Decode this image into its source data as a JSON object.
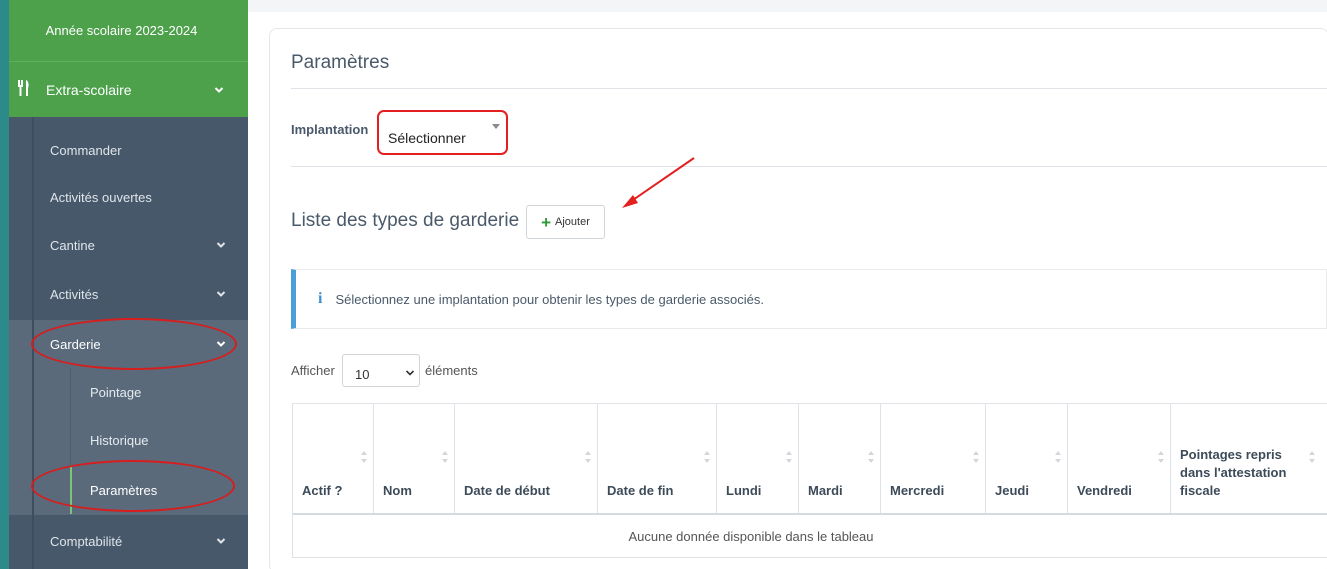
{
  "sidebar": {
    "school_year": "Année scolaire 2023-2024",
    "section": "Extra-scolaire",
    "items": [
      {
        "label": "Commander"
      },
      {
        "label": "Activités ouvertes"
      },
      {
        "label": "Cantine"
      },
      {
        "label": "Activités"
      },
      {
        "label": "Garderie"
      },
      {
        "label": "Comptabilité"
      }
    ],
    "garderie_sub": [
      {
        "label": "Pointage"
      },
      {
        "label": "Historique"
      },
      {
        "label": "Paramètres"
      }
    ]
  },
  "main": {
    "title": "Paramètres",
    "implantation_label": "Implantation",
    "implantation_value": "Sélectionner",
    "list_title": "Liste des types de garderie",
    "add_button": "Ajouter",
    "info_text": "Sélectionnez une implantation pour obtenir les types de garderie associés.",
    "show_label": "Afficher",
    "page_length": "10",
    "show_suffix": "éléments",
    "table": {
      "columns": [
        "Actif ?",
        "Nom",
        "Date de début",
        "Date de fin",
        "Lundi",
        "Mardi",
        "Mercredi",
        "Jeudi",
        "Vendredi",
        "Pointages repris dans l'attestation fiscale"
      ],
      "empty_message": "Aucune donnée disponible dans le tableau"
    }
  },
  "colors": {
    "sidebar_bg": "#47586a",
    "sidebar_green": "#4da14b",
    "annotation_red": "#e22020",
    "info_blue": "#4b9ed7"
  }
}
